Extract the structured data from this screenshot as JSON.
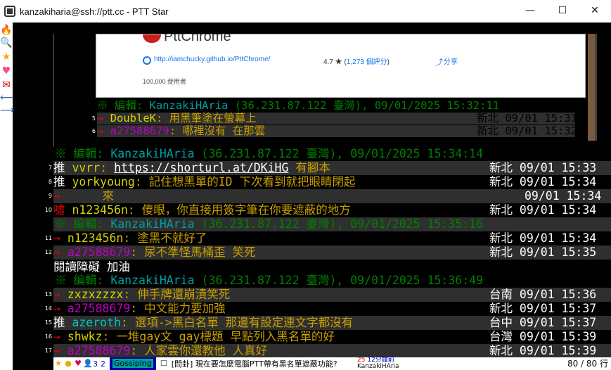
{
  "window": {
    "title": "kanzakiharia@ssh://ptt.cc - PTT Star",
    "minimize": "—",
    "maximize": "☐",
    "close": "✕"
  },
  "sidebar": {
    "icons": [
      "fire-icon",
      "search-icon",
      "star-icon",
      "heart-icon",
      "new-icon",
      "back-icon",
      "forward-icon"
    ]
  },
  "preview": {
    "logo_text": "PttChrome",
    "url": "http://iamchucky.github.io/PttChrome/",
    "rating": "4.7 ★ (",
    "rating_count": "1,273 個評分",
    "rating_close": ")",
    "share": "分享",
    "users": "100,000 使用者"
  },
  "quoted": {
    "edit": {
      "prefix": "※ 編輯:",
      "user": "KanzakiHAria",
      "info": "(36.231.87.122 臺灣), 09/01/2025 15:32:11"
    },
    "rows": [
      {
        "num": "5",
        "tag": "→",
        "id": "DoubleK",
        "text": ": 用黑筆塗在螢幕上",
        "ipdt": "新北 09/01 15:31"
      },
      {
        "num": "6",
        "tag": "→",
        "id": "a27588679",
        "text": ": 哪裡沒有 在那雲",
        "ipdt": "新北 09/01 15:32"
      }
    ]
  },
  "edits": [
    {
      "prefix": "※ 編輯:",
      "user": "KanzakiHAria",
      "info": "(36.231.87.122 臺灣), 09/01/2025 15:34:14"
    },
    {
      "prefix": "※ 編輯:",
      "user": "KanzakiHAria",
      "info": "(36.231.87.122 臺灣), 09/01/2025 15:35:16"
    },
    {
      "prefix": "※ 編輯:",
      "user": "KanzakiHAria",
      "info": "(36.231.87.122 臺灣), 09/01/2025 15:36:49"
    }
  ],
  "pushes": [
    {
      "num": "7",
      "tag": "推",
      "id": "vvrr",
      "text": ": ",
      "url": "https://shorturl.at/DKiHG",
      "rest": " 有腳本",
      "ipdt": "新北 09/01 15:33"
    },
    {
      "num": "8",
      "tag": "推",
      "id": "yorkyoung",
      "text": ": 記住想黑單的ID 下次看到就把眼睛閉起",
      "ipdt": "新北 09/01 15:34"
    },
    {
      "num": "9",
      "tag": "→",
      "id": "",
      "text": "     來",
      "ipdt": "09/01 15:34"
    },
    {
      "num": "10",
      "tag": "噓",
      "id": "n123456n",
      "text": ": 傻眼，你直接用簽字筆在你要遮蔽的地方",
      "ipdt": "新北 09/01 15:34"
    },
    {
      "num": "11",
      "tag": "→",
      "id": "n123456n",
      "text": ": 塗黑不就好了",
      "ipdt": "新北 09/01 15:34"
    },
    {
      "num": "12",
      "tag": "→",
      "id": "a27588679",
      "text": ": 尿不準怪馬桶歪 笑死",
      "ipdt": "新北 09/01 15:35"
    },
    {
      "num": "13",
      "tag": "→",
      "id": "zxzxzzzx",
      "text": ": 伸手牌還崩潰笑死",
      "ipdt": "台南 09/01 15:36"
    },
    {
      "num": "14",
      "tag": "→",
      "id": "a27588679",
      "text": ": 中文能力要加強",
      "ipdt": "新北 09/01 15:37"
    },
    {
      "num": "15",
      "tag": "推",
      "id": "azeroth",
      "text": ": 選項->黑白名單 那邊有設定連文字都沒有",
      "ipdt": "台中 09/01 15:37"
    },
    {
      "num": "16",
      "tag": "→",
      "id": "shwkz",
      "text": ": 一堆gay文 gay標題 早點列入黑名單的好",
      "ipdt": "台灣 09/01 15:39"
    },
    {
      "num": "17",
      "tag": "→",
      "id": "a27588679",
      "text": ": 人家雲你還教他 人真好",
      "ipdt": "新北 09/01 15:39"
    }
  ],
  "plain_line": "閱讀障礙 加油",
  "statusbar": {
    "board": "Gossiping",
    "post_title": "[問卦] 現在要怎麼電腦PTT帶有黑名單遮蔽功能?",
    "meta_count": "25",
    "meta_time": "12分鐘前",
    "meta_author": "KanzakiHAria",
    "online": "3",
    "mail": "2",
    "page": "80 / 80 行"
  },
  "colors": {
    "edit_green": "#008000",
    "user_cyan": "#00a0a0",
    "arrow_red": "#e00000",
    "id_yellow": "#d4d400",
    "text_gold": "#c8a000",
    "row_bg": "#2f2f2f"
  }
}
